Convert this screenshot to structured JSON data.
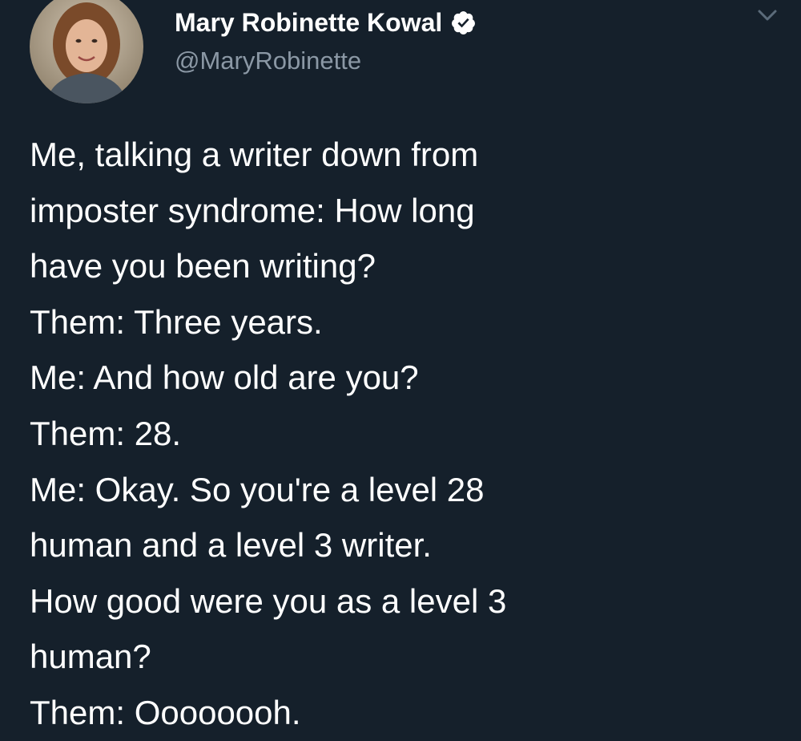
{
  "author": {
    "display_name": "Mary Robinette Kowal",
    "handle": "@MaryRobinette",
    "verified": true
  },
  "icons": {
    "verified": "verified-badge-icon",
    "menu": "chevron-down-icon",
    "avatar": "profile-photo"
  },
  "tweet": {
    "lines": [
      "Me, talking a writer down from",
      "imposter syndrome: How long",
      "have you been writing?",
      "Them: Three years.",
      "Me: And how old are you?",
      "Them: 28.",
      "Me: Okay. So you're a level 28",
      "human and a level 3 writer.",
      "How good were you as a level 3",
      "human?",
      "Them: Oooooooh."
    ]
  },
  "colors": {
    "background": "#15202b",
    "text": "#ffffff",
    "secondary_text": "#8b98a5",
    "verified_badge": "#ffffff"
  }
}
